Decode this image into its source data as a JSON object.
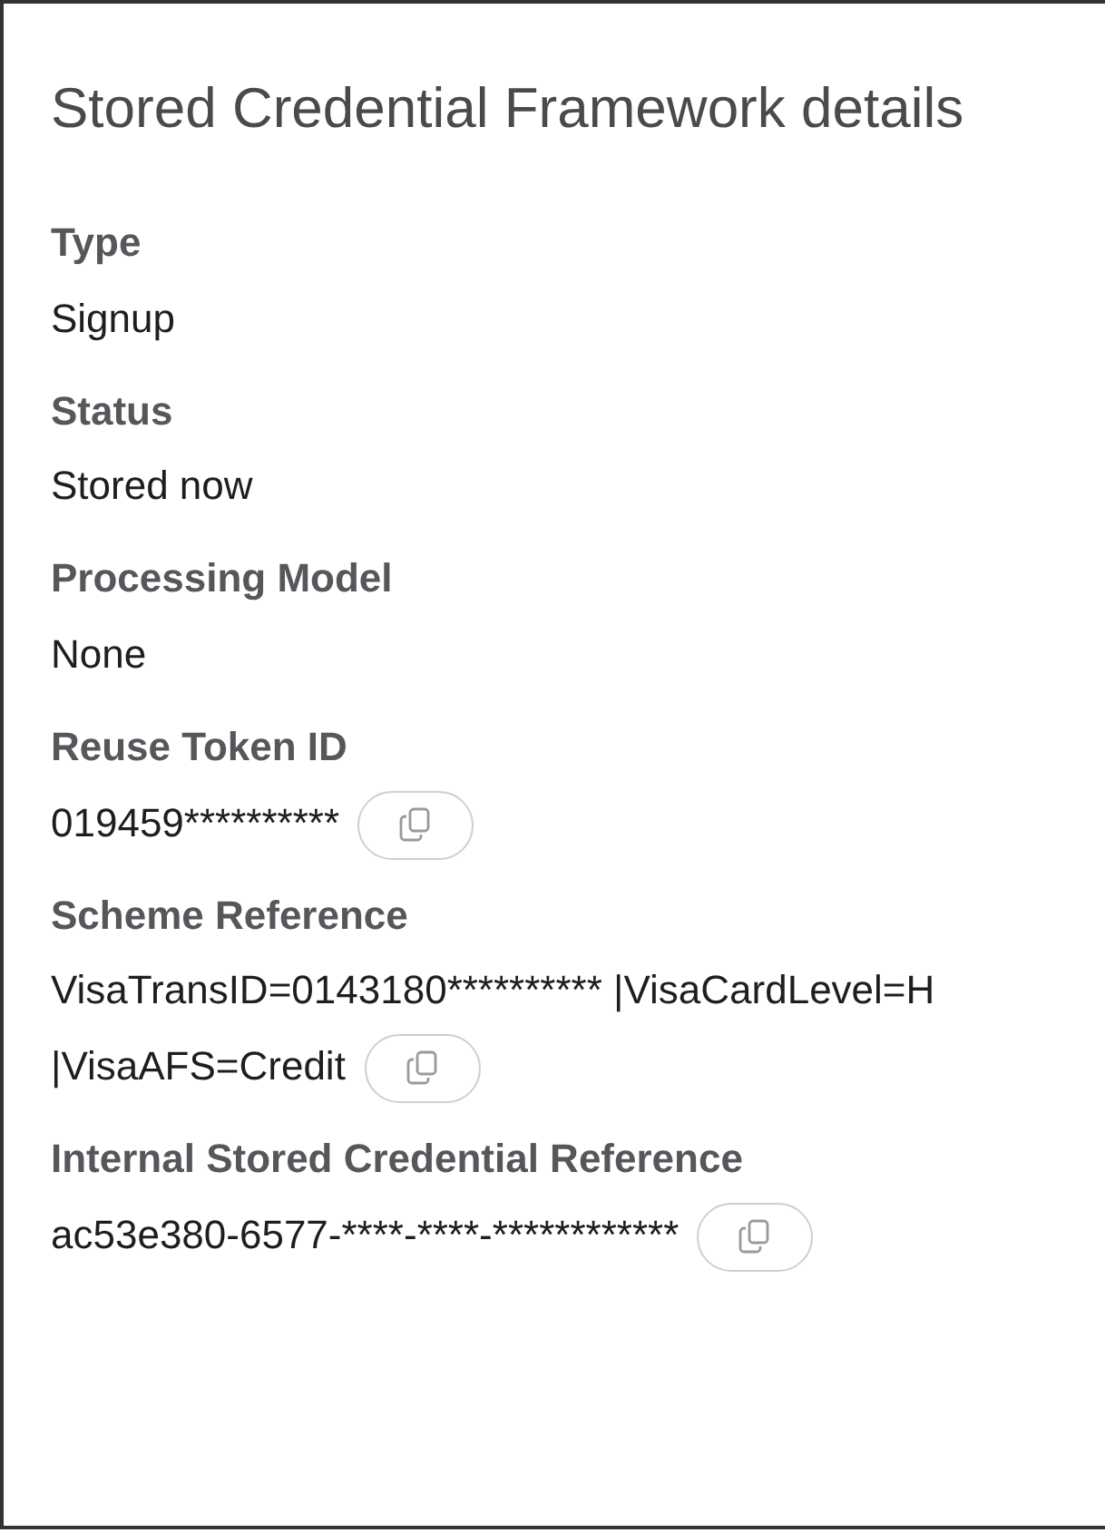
{
  "title": "Stored Credential Framework details",
  "fields": [
    {
      "label": "Type",
      "value": "Signup",
      "copyable": false
    },
    {
      "label": "Status",
      "value": "Stored now",
      "copyable": false
    },
    {
      "label": "Processing Model",
      "value": "None",
      "copyable": false
    },
    {
      "label": "Reuse Token ID",
      "value": "019459**********",
      "copyable": true
    },
    {
      "label": "Scheme Reference",
      "value": [
        "VisaTransID=0143180********** |VisaCardLevel=H",
        "|VisaAFS=Credit"
      ],
      "copyable": true
    },
    {
      "label": "Internal Stored Credential Reference",
      "value": "ac53e380-6577-****-****-************",
      "copyable": true
    }
  ]
}
